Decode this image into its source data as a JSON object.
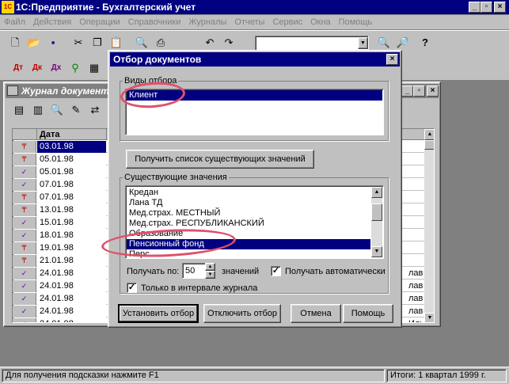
{
  "app": {
    "title": "1С:Предприятие - Бухгалтерский учет",
    "menu": [
      "Файл",
      "Действия",
      "Операции",
      "Справочники",
      "Журналы",
      "Отчеты",
      "Сервис",
      "Окна",
      "Помощь"
    ]
  },
  "toolbar": {
    "help_icon": "?"
  },
  "journal": {
    "title": "Журнал документ",
    "column_date": "Дата",
    "rows": [
      {
        "date": "03.01.98",
        "extra": ""
      },
      {
        "date": "05.01.98",
        "extra": ""
      },
      {
        "date": "05.01.98",
        "extra": ""
      },
      {
        "date": "07.01.98",
        "extra": ""
      },
      {
        "date": "07.01.98",
        "extra": ""
      },
      {
        "date": "13.01.98",
        "extra": ""
      },
      {
        "date": "15.01.98",
        "extra": ""
      },
      {
        "date": "18.01.98",
        "extra": ""
      },
      {
        "date": "19.01.98",
        "extra": ""
      },
      {
        "date": "21.01.98",
        "extra": ""
      },
      {
        "date": "24.01.98",
        "extra": "лав"
      },
      {
        "date": "24.01.98",
        "extra": "лав"
      },
      {
        "date": "24.01.98",
        "extra": "лав"
      },
      {
        "date": "24.01.98",
        "extra": "лав"
      },
      {
        "date": "24.01.98",
        "extra": "Иль"
      }
    ]
  },
  "dialog": {
    "title": "Отбор документов",
    "filter_types_label": "Виды отбора",
    "filter_types": [
      "Клиент"
    ],
    "get_list_button": "Получить список существующих значений",
    "existing_values_label": "Существующие значения",
    "existing_values": [
      "Кредан",
      "Лана ТД",
      "Мед.страх. МЕСТНЫЙ",
      "Мед.страх. РЕСПУБЛИКАНСКИЙ",
      "Образование",
      "Пенсионный фонд",
      "Перс"
    ],
    "selected_value": "Пенсионный фонд",
    "fetch_by_label": "Получать по:",
    "fetch_by_value": "50",
    "values_label": "значений",
    "auto_fetch_label": "Получать автоматически",
    "auto_fetch_checked": "✓",
    "only_interval_label": "Только в интервале журнала",
    "only_interval_checked": "✓",
    "buttons": {
      "set": "Установить отбор",
      "clear": "Отключить отбор",
      "cancel": "Отмена",
      "help": "Помощь"
    }
  },
  "status": {
    "hint": "Для получения подсказки нажмите F1",
    "totals": "Итоги: 1 квартал 1999 г."
  },
  "colors": {
    "titlebar": "#000080",
    "face": "#c0c0c0",
    "highlight_ellipse": "#e0506a"
  }
}
